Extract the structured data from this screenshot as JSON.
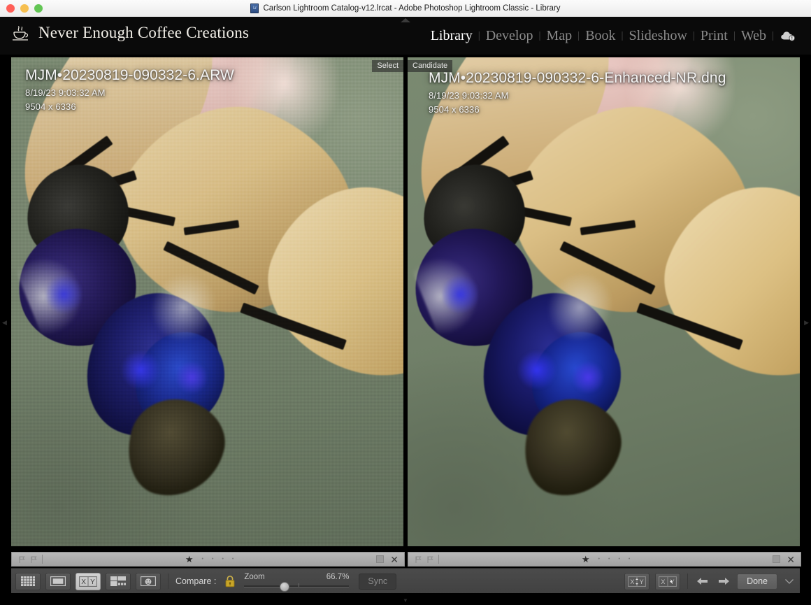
{
  "window": {
    "title": "Carlson Lightroom Catalog-v12.lrcat - Adobe Photoshop Lightroom Classic - Library",
    "app_icon": "lightroom-classic-icon",
    "traffic_lights": [
      "close",
      "minimize",
      "maximize"
    ]
  },
  "identity_plate": {
    "text": "Never Enough Coffee Creations",
    "icon": "coffee-cup-icon"
  },
  "modules": {
    "items": [
      {
        "label": "Library",
        "active": true
      },
      {
        "label": "Develop",
        "active": false
      },
      {
        "label": "Map",
        "active": false
      },
      {
        "label": "Book",
        "active": false
      },
      {
        "label": "Slideshow",
        "active": false
      },
      {
        "label": "Print",
        "active": false
      },
      {
        "label": "Web",
        "active": false
      }
    ],
    "separator": "|",
    "cloud_icon": "cloud-sync-status-icon"
  },
  "compare_view": {
    "left": {
      "badge": "Select",
      "filename": "MJM•20230819-090332-6.ARW",
      "capture_time": "8/19/23 9:03:32 AM",
      "dimensions": "9504 x 6336"
    },
    "right": {
      "badge": "Candidate",
      "filename": "MJM•20230819-090332-6-Enhanced-NR.dng",
      "capture_time": "8/19/23 9:03:32 AM",
      "dimensions": "9504 x 6336"
    }
  },
  "rating_bars": {
    "flag_pick_icon": "flag-pick-icon",
    "flag_reject_icon": "flag-reject-icon",
    "stars_filled": 1,
    "stars_total": 5,
    "star_filled_glyph": "★",
    "star_empty_glyph": "•",
    "color_label_icon": "color-label-swatch",
    "reject_icon": "close-x-icon"
  },
  "toolbar": {
    "view_modes": [
      {
        "name": "grid-view",
        "icon": "grid-view-icon",
        "active": false
      },
      {
        "name": "loupe-view",
        "icon": "loupe-view-icon",
        "active": false
      },
      {
        "name": "compare-view",
        "icon": "compare-xy-icon",
        "active": true
      },
      {
        "name": "survey-view",
        "icon": "survey-view-icon",
        "active": false
      },
      {
        "name": "people-view",
        "icon": "people-view-icon",
        "active": false
      }
    ],
    "compare_label": "Compare :",
    "lock_icon": "padlock-locked-icon",
    "lock_state": "locked",
    "zoom_label": "Zoom",
    "zoom_value": "66.7%",
    "zoom_slider_position_pct": 34,
    "sync_label": "Sync",
    "sync_enabled": false,
    "swap_button_icon": "swap-xy-icon",
    "make_select_button_icon": "make-select-xy-icon",
    "prev_icon": "arrow-left-icon",
    "next_icon": "arrow-right-icon",
    "done_label": "Done",
    "toolbar_caret_icon": "chevron-down-icon"
  },
  "panel_handles": {
    "top": "▲",
    "left": "◀",
    "right": "▶",
    "bottom": "▼"
  },
  "colors": {
    "chrome_bg": "#0a0a0a",
    "toolbar_bg": "#454545",
    "accent_active_text": "#ffffff",
    "inactive_text": "#8a8a8a",
    "lock_gold": "#c8a528",
    "rating_bar": "#aeaeae"
  }
}
